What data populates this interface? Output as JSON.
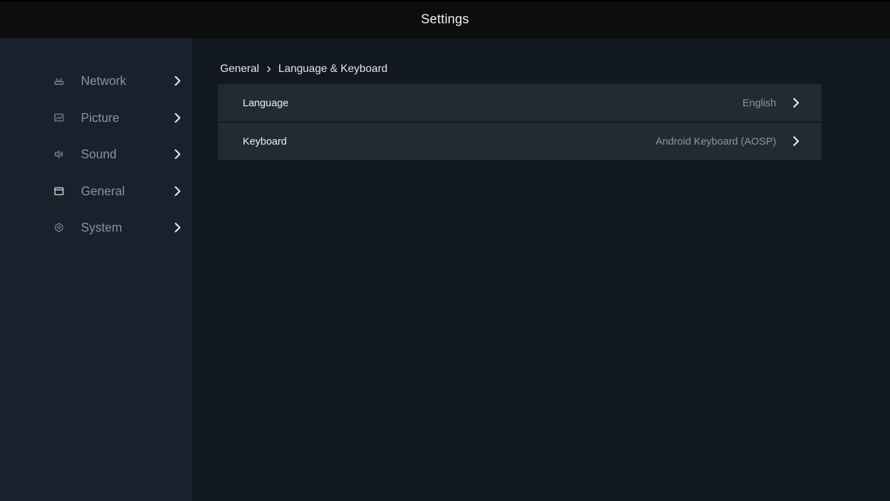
{
  "window": {
    "title": "Settings"
  },
  "sidebar": {
    "items": [
      {
        "label": "Network",
        "icon": "router-icon"
      },
      {
        "label": "Picture",
        "icon": "picture-icon"
      },
      {
        "label": "Sound",
        "icon": "speaker-icon"
      },
      {
        "label": "General",
        "icon": "window-icon"
      },
      {
        "label": "System",
        "icon": "gear-icon"
      }
    ]
  },
  "breadcrumb": {
    "parent": "General",
    "current": "Language & Keyboard"
  },
  "settings": {
    "rows": [
      {
        "label": "Language",
        "value": "English"
      },
      {
        "label": "Keyboard",
        "value": "Android Keyboard (AOSP)"
      }
    ]
  },
  "colors": {
    "titlebar": "#0c0d0f",
    "sidebar": "#18212c",
    "content": "#121820",
    "row": "#222a34",
    "text_primary": "#f0f2f4",
    "text_secondary": "#8f969e"
  }
}
